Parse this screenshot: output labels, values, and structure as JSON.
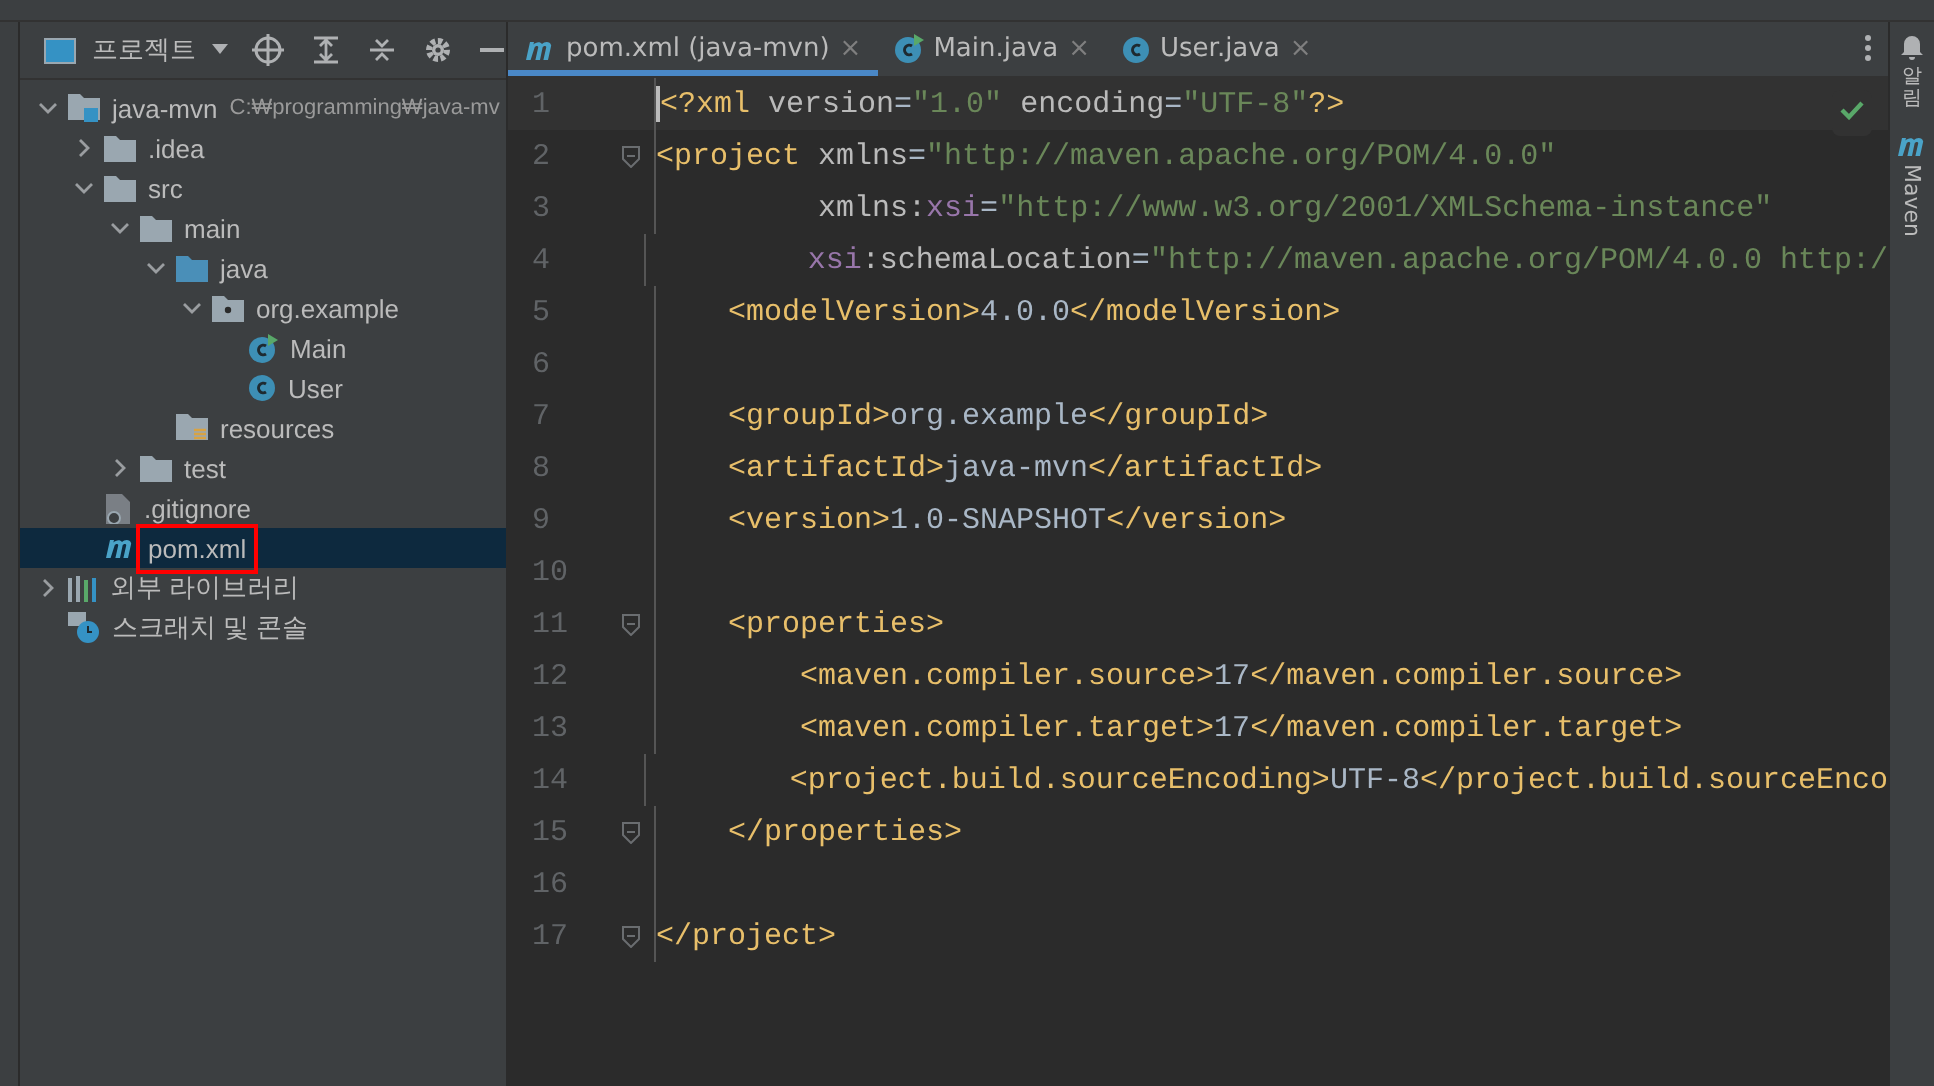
{
  "project_panel": {
    "title": "프로젝트",
    "tree": [
      {
        "label": "java-mvn",
        "hint": "C:₩programming₩java-mv",
        "kind": "module",
        "expanded": true,
        "selected": false,
        "children": [
          {
            "label": ".idea",
            "kind": "folder",
            "expanded": false,
            "selected": false
          },
          {
            "label": "src",
            "kind": "folder",
            "expanded": true,
            "selected": false,
            "children": [
              {
                "label": "main",
                "kind": "folder",
                "expanded": true,
                "selected": false,
                "children": [
                  {
                    "label": "java",
                    "kind": "source-folder",
                    "expanded": true,
                    "selected": false,
                    "children": [
                      {
                        "label": "org.example",
                        "kind": "package",
                        "expanded": true,
                        "selected": false,
                        "children": [
                          {
                            "label": "Main",
                            "kind": "class-run",
                            "selected": false
                          },
                          {
                            "label": "User",
                            "kind": "class",
                            "selected": false
                          }
                        ]
                      }
                    ]
                  },
                  {
                    "label": "resources",
                    "kind": "resources",
                    "selected": false
                  }
                ]
              },
              {
                "label": "test",
                "kind": "folder",
                "expanded": false,
                "selected": false
              }
            ]
          },
          {
            "label": ".gitignore",
            "kind": "file",
            "selected": false
          },
          {
            "label": "pom.xml",
            "kind": "maven",
            "selected": true,
            "annotated": true
          }
        ]
      },
      {
        "label": "외부 라이브러리",
        "kind": "libraries",
        "expanded": false,
        "selected": false
      },
      {
        "label": "스크래치 및 콘솔",
        "kind": "scratch",
        "selected": false
      }
    ]
  },
  "tabs": [
    {
      "label": "pom.xml (java-mvn)",
      "kind": "maven",
      "selected": true,
      "close": "×"
    },
    {
      "label": "Main.java",
      "kind": "class-run",
      "selected": false,
      "close": "×"
    },
    {
      "label": "User.java",
      "kind": "class",
      "selected": false,
      "close": "×"
    }
  ],
  "editor": {
    "lines": [
      {
        "number": "1",
        "current": true,
        "fold": false,
        "tokens": [
          {
            "kind": "tag",
            "text": "<?xml "
          },
          {
            "kind": "attr",
            "text": "version"
          },
          {
            "kind": "text",
            "text": "="
          },
          {
            "kind": "value",
            "text": "\"1.0\""
          },
          {
            "kind": "attr",
            "text": " encoding"
          },
          {
            "kind": "text",
            "text": "="
          },
          {
            "kind": "value",
            "text": "\"UTF-8\""
          },
          {
            "kind": "tag",
            "text": "?>"
          }
        ]
      },
      {
        "number": "2",
        "current": false,
        "fold": true,
        "tokens": [
          {
            "kind": "tag",
            "text": "<project "
          },
          {
            "kind": "attr",
            "text": "xmlns"
          },
          {
            "kind": "text",
            "text": "="
          },
          {
            "kind": "value",
            "text": "\"http://maven.apache.org/POM/4.0.0\""
          }
        ]
      },
      {
        "number": "3",
        "current": false,
        "fold": false,
        "tokens": [
          {
            "kind": "attr",
            "text": "         xmlns:"
          },
          {
            "kind": "ns",
            "text": "xsi"
          },
          {
            "kind": "text",
            "text": "="
          },
          {
            "kind": "value",
            "text": "\"http://www.w3.org/2001/XMLSchema-instance\""
          }
        ]
      },
      {
        "number": "4",
        "current": false,
        "fold": false,
        "tokens": [
          {
            "kind": "ns",
            "text": "         xsi"
          },
          {
            "kind": "attr",
            "text": ":schemaLocation"
          },
          {
            "kind": "text",
            "text": "="
          },
          {
            "kind": "value",
            "text": "\"http://maven.apache.org/POM/4.0.0 http:/"
          }
        ]
      },
      {
        "number": "5",
        "current": false,
        "fold": false,
        "tokens": [
          {
            "kind": "tag",
            "text": "    <modelVersion>"
          },
          {
            "kind": "text",
            "text": "4.0.0"
          },
          {
            "kind": "tag",
            "text": "</modelVersion>"
          }
        ]
      },
      {
        "number": "6",
        "current": false,
        "fold": false
      },
      {
        "number": "7",
        "current": false,
        "fold": false,
        "tokens": [
          {
            "kind": "tag",
            "text": "    <groupId>"
          },
          {
            "kind": "text",
            "text": "org.example"
          },
          {
            "kind": "tag",
            "text": "</groupId>"
          }
        ]
      },
      {
        "number": "8",
        "current": false,
        "fold": false,
        "tokens": [
          {
            "kind": "tag",
            "text": "    <artifactId>"
          },
          {
            "kind": "text",
            "text": "java-mvn"
          },
          {
            "kind": "tag",
            "text": "</artifactId>"
          }
        ]
      },
      {
        "number": "9",
        "current": false,
        "fold": false,
        "tokens": [
          {
            "kind": "tag",
            "text": "    <version>"
          },
          {
            "kind": "text",
            "text": "1.0-SNAPSHOT"
          },
          {
            "kind": "tag",
            "text": "</version>"
          }
        ]
      },
      {
        "number": "10",
        "current": false,
        "fold": false
      },
      {
        "number": "11",
        "current": false,
        "fold": true,
        "tokens": [
          {
            "kind": "tag",
            "text": "    <properties>"
          }
        ]
      },
      {
        "number": "12",
        "current": false,
        "fold": false,
        "tokens": [
          {
            "kind": "tag",
            "text": "        <maven.compiler.source>"
          },
          {
            "kind": "text",
            "text": "17"
          },
          {
            "kind": "tag",
            "text": "</maven.compiler.source>"
          }
        ]
      },
      {
        "number": "13",
        "current": false,
        "fold": false,
        "tokens": [
          {
            "kind": "tag",
            "text": "        <maven.compiler.target>"
          },
          {
            "kind": "text",
            "text": "17"
          },
          {
            "kind": "tag",
            "text": "</maven.compiler.target>"
          }
        ]
      },
      {
        "number": "14",
        "current": false,
        "fold": false,
        "tokens": [
          {
            "kind": "tag",
            "text": "        <project.build.sourceEncoding>"
          },
          {
            "kind": "text",
            "text": "UTF-8"
          },
          {
            "kind": "tag",
            "text": "</project.build.sourceEnco"
          }
        ]
      },
      {
        "number": "15",
        "current": false,
        "fold": true,
        "tokens": [
          {
            "kind": "tag",
            "text": "    </properties>"
          }
        ]
      },
      {
        "number": "16",
        "current": false,
        "fold": false
      },
      {
        "number": "17",
        "current": false,
        "fold": true,
        "tokens": [
          {
            "kind": "tag",
            "text": "</project>"
          }
        ]
      }
    ]
  },
  "right_stripe": [
    {
      "label": "알림",
      "kind": "notifications"
    },
    {
      "label": "Maven",
      "kind": "maven"
    }
  ]
}
